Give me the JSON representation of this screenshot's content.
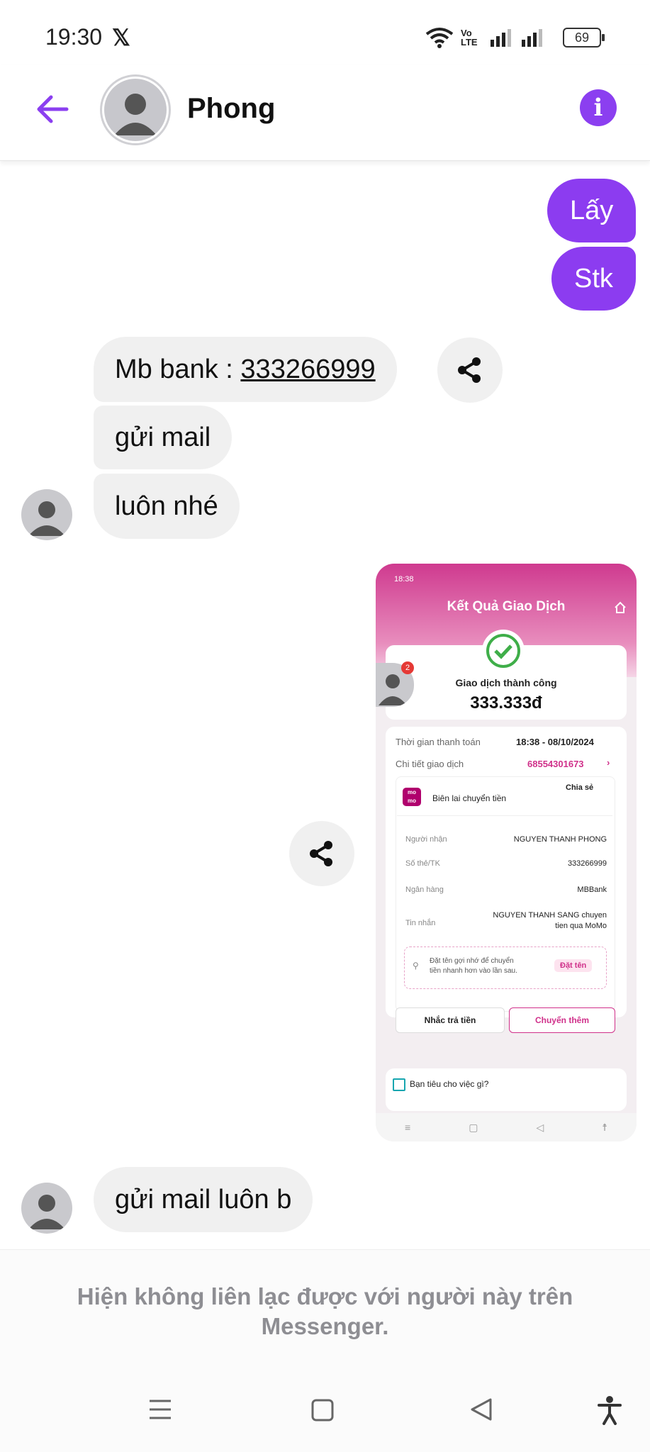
{
  "status_bar": {
    "time": "19:30",
    "x_logo": "𝕏",
    "net": "Vo LTE",
    "battery": "69"
  },
  "header": {
    "name": "Phong"
  },
  "messages": {
    "out1": "Lấy",
    "out2": "Stk",
    "in1_prefix": "Mb bank : ",
    "in1_number": "333266999",
    "in2": "gửi mail",
    "in3": "luôn nhé",
    "in4": "gửi mail luôn b"
  },
  "momo": {
    "time": "18:38",
    "title": "Kết Quả Giao Dịch",
    "badge": "2",
    "status": "Giao dịch thành công",
    "amount": "333.333đ",
    "pay_time_label": "Thời gian thanh toán",
    "pay_time": "18:38 - 08/10/2024",
    "detail_label": "Chi tiết giao dịch",
    "detail_value": "68554301673",
    "logo": "mo mo",
    "receipt": "Biên lai chuyển tiền",
    "share": "Chia sẻ",
    "receiver_label": "Người nhận",
    "receiver": "NGUYEN THANH PHONG",
    "account_label": "Số thẻ/TK",
    "account": "333266999",
    "bank_label": "Ngân hàng",
    "bank": "MBBank",
    "message_label": "Tin nhắn",
    "message_1": "NGUYEN THANH SANG chuyen",
    "message_2": "tien qua MoMo",
    "hint_1": "Đặt tên gợi nhớ để chuyển",
    "hint_2": "tiền nhanh hơn vào lần sau.",
    "name_btn": "Đặt tên",
    "remind_btn": "Nhắc trả tiền",
    "more_btn": "Chuyển thêm",
    "spend": "Bạn tiêu cho việc gì?"
  },
  "footer": {
    "line1": "Hiện không liên lạc được với người này trên",
    "line2": "Messenger."
  },
  "colors": {
    "accent": "#8c3cf0",
    "momo_pink": "#d0308a"
  }
}
